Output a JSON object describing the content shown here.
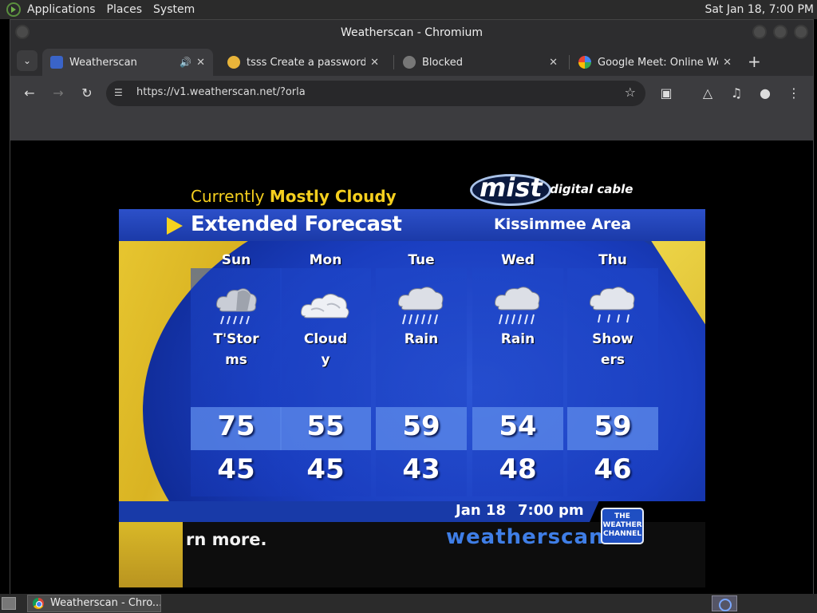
{
  "top_panel": {
    "menus": [
      "Applications",
      "Places",
      "System"
    ],
    "clock": "Sat Jan 18,  7:00 PM"
  },
  "window": {
    "title": "Weatherscan - Chromium"
  },
  "tabs": [
    {
      "label": "Weatherscan",
      "active": true,
      "favicon": "weatherscan-favicon",
      "audio": true
    },
    {
      "label": "tsss Create a password-p",
      "active": false,
      "favicon": "emoji-favicon"
    },
    {
      "label": "Blocked",
      "active": false,
      "favicon": "globe-favicon"
    },
    {
      "label": "Google Meet: Online Web",
      "active": false,
      "favicon": "google-favicon"
    }
  ],
  "toolbar": {
    "url": "https://v1.weatherscan.net/?orla"
  },
  "weatherscan": {
    "current_label": "Currently",
    "current_condition": "Mostly Cloudy",
    "logo_text": "mist",
    "logo_sub": "digital cable",
    "banner_title": "Extended Forecast",
    "area": "Kissimmee Area",
    "forecast": [
      {
        "day": "Sun",
        "condition": "T'Storms",
        "icon": "thunderstorm-icon",
        "high": "75",
        "low": "45"
      },
      {
        "day": "Mon",
        "condition": "Cloudy",
        "icon": "cloudy-icon",
        "high": "55",
        "low": "45"
      },
      {
        "day": "Tue",
        "condition": "Rain",
        "icon": "rain-icon",
        "high": "59",
        "low": "43"
      },
      {
        "day": "Wed",
        "condition": "Rain",
        "icon": "rain-icon",
        "high": "54",
        "low": "48"
      },
      {
        "day": "Thu",
        "condition": "Showers",
        "icon": "showers-icon",
        "high": "59",
        "low": "46"
      }
    ],
    "date": "Jan 18",
    "time": "7:00 pm",
    "ticker": "rn more.",
    "brand": "weatherscan",
    "twc_logo": "THE WEATHER CHANNEL"
  },
  "taskbar": {
    "window_button": "Weatherscan - Chro..."
  },
  "colors": {
    "accent_yellow": "#f5cf1e",
    "banner_blue": "#1b3aa8",
    "panel_blue": "#2c56d6"
  }
}
